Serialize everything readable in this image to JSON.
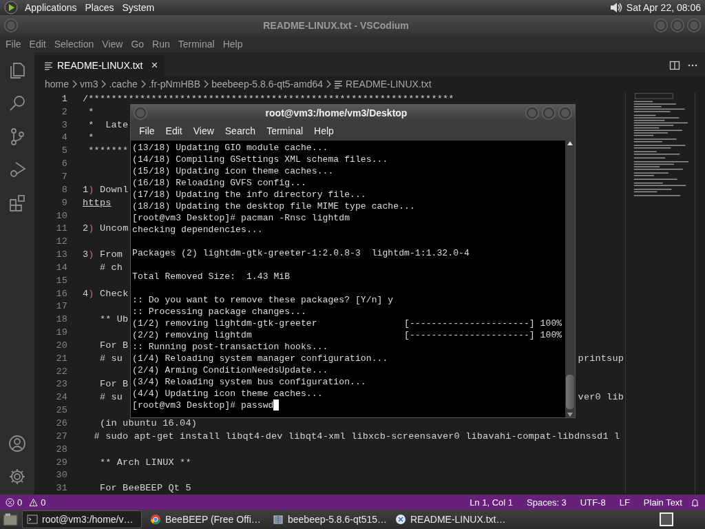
{
  "top_panel": {
    "menus": [
      "Applications",
      "Places",
      "System"
    ],
    "clock": "Sat Apr 22, 08:06"
  },
  "editor_window": {
    "title": "README-LINUX.txt - VSCodium",
    "menu": [
      "File",
      "Edit",
      "Selection",
      "View",
      "Go",
      "Run",
      "Terminal",
      "Help"
    ],
    "tab": {
      "label": "README-LINUX.txt",
      "close": "×",
      "selected": true
    },
    "breadcrumbs": [
      "home",
      "vm3",
      ".cache",
      ".fr-pNmHBB",
      "beebeep-5.8.6-qt5-amd64",
      "README-LINUX.txt"
    ],
    "lines": [
      {
        "number": "1",
        "kind": "text",
        "text": "/****************************************************************"
      },
      {
        "number": "2",
        "kind": "text",
        "text": " *"
      },
      {
        "number": "3",
        "kind": "text",
        "text": " *  Late"
      },
      {
        "number": "4",
        "kind": "text",
        "text": " *"
      },
      {
        "number": "5",
        "kind": "text",
        "text": " *******"
      },
      {
        "number": "6",
        "kind": "text"
      },
      {
        "number": "7",
        "kind": "text"
      },
      {
        "number": "8",
        "kind": "numbered",
        "marker": "1",
        "bracket": ")",
        "text": " Downl"
      },
      {
        "number": "9",
        "kind": "link",
        "text": "https"
      },
      {
        "number": "10",
        "kind": "text"
      },
      {
        "number": "11",
        "kind": "numbered",
        "marker": "2",
        "bracket": ")",
        "text": " Uncom"
      },
      {
        "number": "12",
        "kind": "text"
      },
      {
        "number": "13",
        "kind": "numbered",
        "marker": "3",
        "bracket": ")",
        "text": " From"
      },
      {
        "number": "14",
        "kind": "text",
        "text": "   # ch"
      },
      {
        "number": "15",
        "kind": "text"
      },
      {
        "number": "16",
        "kind": "numbered",
        "marker": "4",
        "bracket": ")",
        "text": " Check"
      },
      {
        "number": "17",
        "kind": "text"
      },
      {
        "number": "18",
        "kind": "text",
        "text": "   ** Ub"
      },
      {
        "number": "19",
        "kind": "text"
      },
      {
        "number": "20",
        "kind": "text",
        "text": "   For B"
      },
      {
        "number": "21",
        "kind": "text",
        "text": "   # su",
        "text_right": "printsup"
      },
      {
        "number": "22",
        "kind": "text"
      },
      {
        "number": "23",
        "kind": "text",
        "text": "   For B"
      },
      {
        "number": "24",
        "kind": "text",
        "text": "   # su",
        "text_right": "ver0 lib"
      },
      {
        "number": "25",
        "kind": "text"
      },
      {
        "number": "26",
        "kind": "text",
        "text": "   (in ubuntu 16.04)"
      },
      {
        "number": "27",
        "kind": "text",
        "text": "  # sudo apt-get install libqt4-dev libqt4-xml libxcb-screensaver0 libavahi-compat-libdnssd1 l"
      },
      {
        "number": "28",
        "kind": "text"
      },
      {
        "number": "29",
        "kind": "text",
        "text": "   ** Arch LINUX **"
      },
      {
        "number": "30",
        "kind": "text"
      },
      {
        "number": "31",
        "kind": "text",
        "text": "   For BeeBEEP Qt 5"
      }
    ],
    "status_bar": {
      "errors": "0",
      "warnings": "0",
      "items": [
        "Ln 1, Col 1",
        "Spaces: 3",
        "UTF-8",
        "LF",
        "Plain Text"
      ]
    }
  },
  "terminal": {
    "title": "root@vm3:/home/vm3/Desktop",
    "menu": [
      "File",
      "Edit",
      "View",
      "Search",
      "Terminal",
      "Help"
    ],
    "blocks": [
      [
        "(13/18) Updating GIO module cache...",
        "(14/18) Compiling GSettings XML schema files...",
        "(15/18) Updating icon theme caches...",
        "(16/18) Reloading GVFS config...",
        "(17/18) Updating the info directory file...",
        "(18/18) Updating the desktop file MIME type cache...",
        "[root@vm3 Desktop]# pacman -Rnsc lightdm",
        "checking dependencies..."
      ],
      [
        "Packages (2) lightdm-gtk-greeter-1:2.0.8-3  lightdm-1:1.32.0-4"
      ],
      [
        "Total Removed Size:  1.43 MiB"
      ],
      [
        ":: Do you want to remove these packages? [Y/n] y",
        ":: Processing package changes...",
        "(1/2) removing lightdm-gtk-greeter                [----------------------] 100%",
        "(2/2) removing lightdm                            [----------------------] 100%",
        ":: Running post-transaction hooks...",
        "(1/4) Reloading system manager configuration...",
        "(2/4) Arming ConditionNeedsUpdate...",
        "(3/4) Reloading system bus configuration...",
        "(4/4) Updating icon theme caches...",
        "[root@vm3 Desktop]# passwd"
      ]
    ]
  },
  "taskbar": {
    "tasks": [
      {
        "label": "root@vm3:/home/v…",
        "kind": "terminal",
        "selected": true
      },
      {
        "label": "BeeBEEP (Free Offi…",
        "kind": "browser",
        "selected": false
      },
      {
        "label": "beebeep-5.8.6-qt515…",
        "kind": "archive",
        "selected": false
      },
      {
        "label": "README-LINUX.txt…",
        "kind": "editor",
        "selected": false
      }
    ]
  }
}
